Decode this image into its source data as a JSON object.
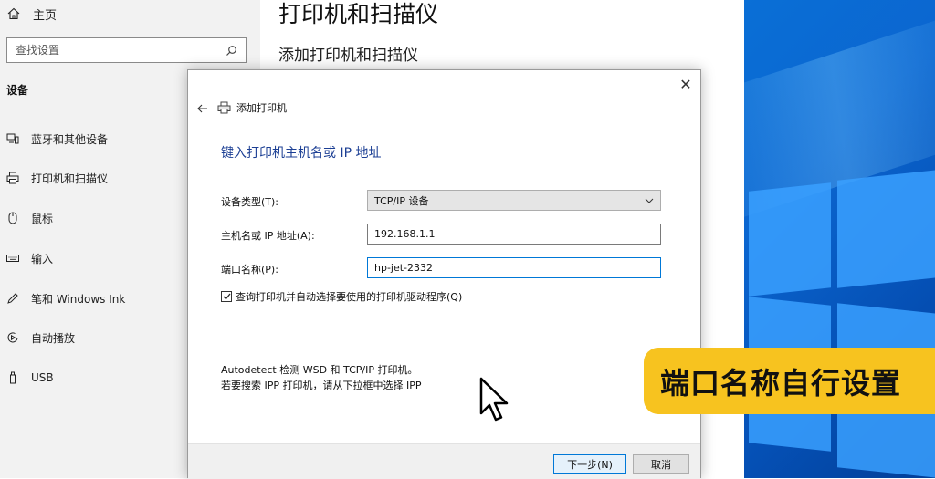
{
  "sidebar": {
    "home_label": "主页",
    "search_placeholder": "查找设置",
    "section_title": "设备",
    "items": [
      {
        "label": "蓝牙和其他设备",
        "icon": "bluetooth-devices-icon"
      },
      {
        "label": "打印机和扫描仪",
        "icon": "printer-icon"
      },
      {
        "label": "鼠标",
        "icon": "mouse-icon"
      },
      {
        "label": "输入",
        "icon": "keyboard-icon"
      },
      {
        "label": "笔和 Windows Ink",
        "icon": "pen-icon"
      },
      {
        "label": "自动播放",
        "icon": "autoplay-icon"
      },
      {
        "label": "USB",
        "icon": "usb-icon"
      }
    ]
  },
  "main": {
    "title": "打印机和扫描仪",
    "subtitle": "添加打印机和扫描仪"
  },
  "dialog": {
    "title": "添加打印机",
    "heading": "键入打印机主机名或 IP 地址",
    "device_type_label": "设备类型(T):",
    "device_type_value": "TCP/IP 设备",
    "hostname_label": "主机名或 IP 地址(A):",
    "hostname_value": "192.168.1.1",
    "port_label": "端口名称(P):",
    "port_value": "hp-jet-2332",
    "checkbox_label": "查询打印机并自动选择要使用的打印机驱动程序(Q)",
    "checkbox_checked": true,
    "info_line1": "Autodetect 检测 WSD 和 TCP/IP 打印机。",
    "info_line2": "若要搜索 IPP 打印机，请从下拉框中选择 IPP",
    "next_button": "下一步(N)",
    "cancel_button": "取消",
    "close_glyph": "✕"
  },
  "overlay": {
    "caption": "端口名称自行设置",
    "caption_bg": "#f7c31f"
  },
  "colors": {
    "accent": "#0078d7",
    "heading": "#1c3f94",
    "desktop": "#0b66d0"
  }
}
